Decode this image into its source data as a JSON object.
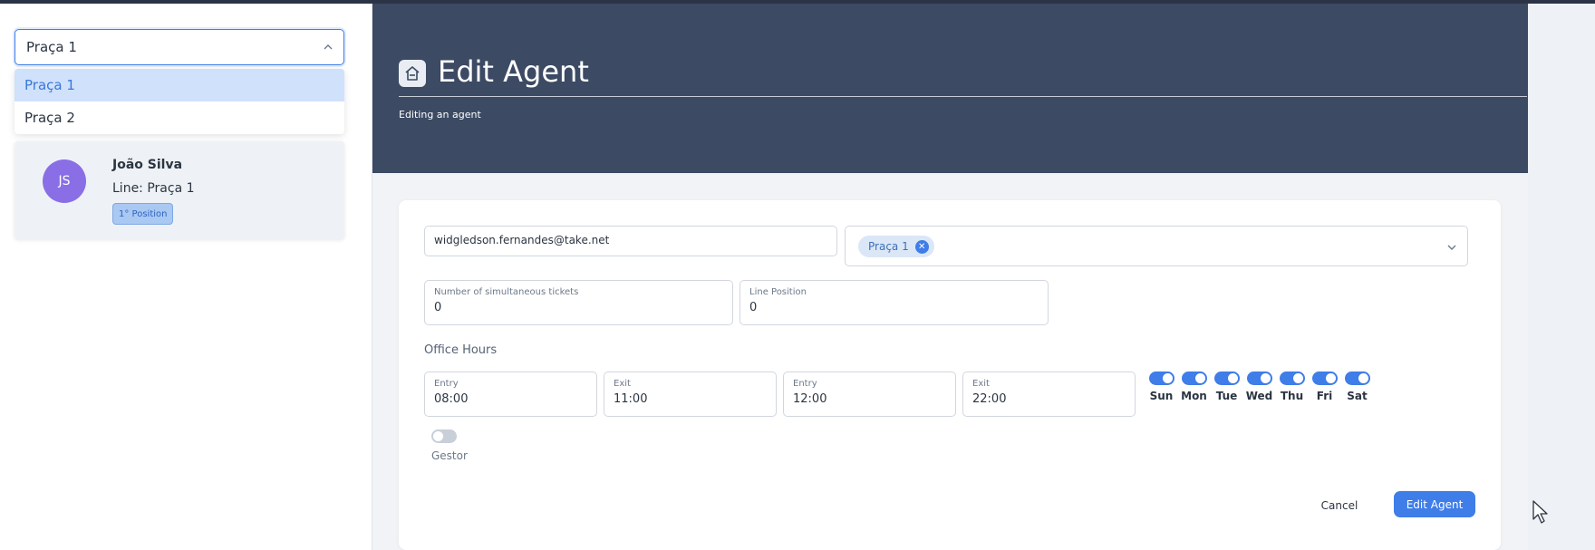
{
  "line_select": {
    "value": "Praça 1",
    "options": [
      "Praça 1",
      "Praça 2"
    ]
  },
  "agent_card": {
    "initials": "JS",
    "name": "João Silva",
    "line": "Line: Praça 1",
    "position_badge": "1° Position"
  },
  "header": {
    "title": "Edit Agent",
    "subtitle": "Editing an agent"
  },
  "form": {
    "email": "widgledson.fernandes@take.net",
    "lines_tag": "Praça 1",
    "tickets": {
      "label": "Number of simultaneous tickets",
      "value": "0"
    },
    "line_position": {
      "label": "Line Position",
      "value": "0"
    },
    "office_hours_label": "Office Hours",
    "hours": [
      {
        "label": "Entry",
        "value": "08:00"
      },
      {
        "label": "Exit",
        "value": "11:00"
      },
      {
        "label": "Entry",
        "value": "12:00"
      },
      {
        "label": "Exit",
        "value": "22:00"
      }
    ],
    "days": [
      {
        "label": "Sun",
        "on": true
      },
      {
        "label": "Mon",
        "on": true
      },
      {
        "label": "Tue",
        "on": true
      },
      {
        "label": "Wed",
        "on": true
      },
      {
        "label": "Thu",
        "on": true
      },
      {
        "label": "Fri",
        "on": true
      },
      {
        "label": "Sat",
        "on": true
      }
    ],
    "gestor": {
      "label": "Gestor",
      "on": false
    },
    "cancel_label": "Cancel",
    "submit_label": "Edit Agent"
  },
  "colors": {
    "accent": "#3f7de8",
    "header_bg": "#3c4a63",
    "avatar_bg": "#8a6ee6"
  }
}
